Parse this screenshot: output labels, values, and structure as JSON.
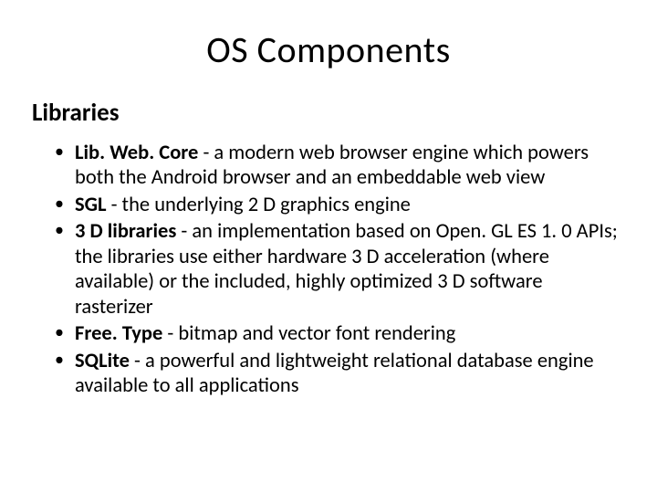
{
  "title": "OS Components",
  "subtitle": "Libraries",
  "bullets": [
    {
      "term": "Lib. Web. Core",
      "desc": " - a modern web browser engine which powers both the Android browser and an embeddable web view"
    },
    {
      "term": "SGL",
      "desc": " - the underlying 2 D graphics engine"
    },
    {
      "term": "3 D libraries",
      "desc": " - an implementation based on Open. GL ES 1. 0 APIs; the libraries use either hardware 3 D acceleration (where available) or the included, highly optimized 3 D software rasterizer"
    },
    {
      "term": "Free. Type",
      "desc": " - bitmap and vector font rendering"
    },
    {
      "term": "SQLite",
      "desc": " - a powerful and lightweight relational database engine available to all applications"
    }
  ]
}
